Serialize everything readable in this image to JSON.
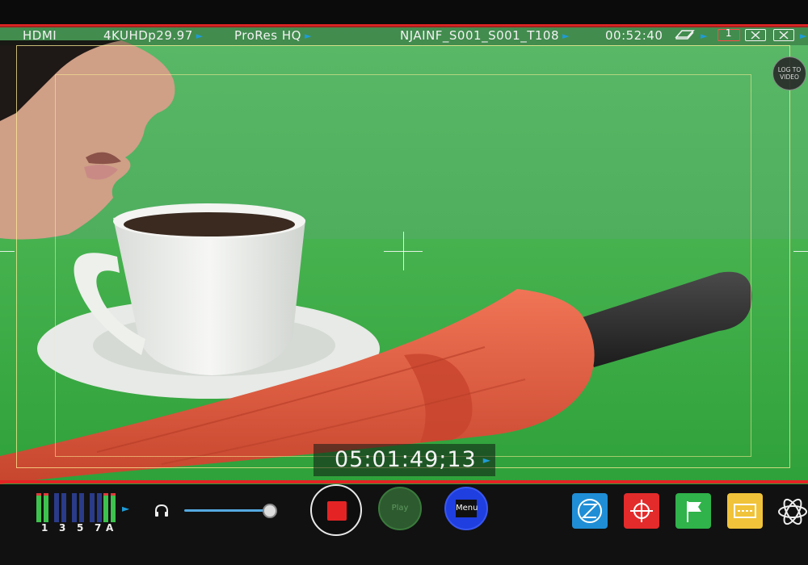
{
  "status": {
    "input": "HDMI",
    "format": "4KUHDp29.97",
    "codec": "ProRes HQ",
    "clip_name": "NJAINF_S001_S001_T108",
    "remaining_time": "00:52:40",
    "record_channel": "1"
  },
  "log_to_video": "LOG TO VIDEO",
  "timecode": "05:01:49;13",
  "audio": {
    "channel_labels": [
      "1",
      "3",
      "5",
      "7",
      "A"
    ]
  },
  "controls": {
    "play_label": "Play",
    "menu_label": "Menu"
  },
  "icons": {
    "disk": "disk-icon",
    "record_indicator": "record-channel-icon",
    "close": "x-box-icon",
    "headphone": "headphone-icon",
    "scopes": "scopes-icon",
    "focus": "crosshair-icon",
    "cue": "flag-icon",
    "display": "display-icon",
    "logo": "atomos-logo-icon"
  },
  "colors": {
    "record_red": "#e42424",
    "accent_blue": "#1f9bd7",
    "greenscreen": "#55b463"
  }
}
